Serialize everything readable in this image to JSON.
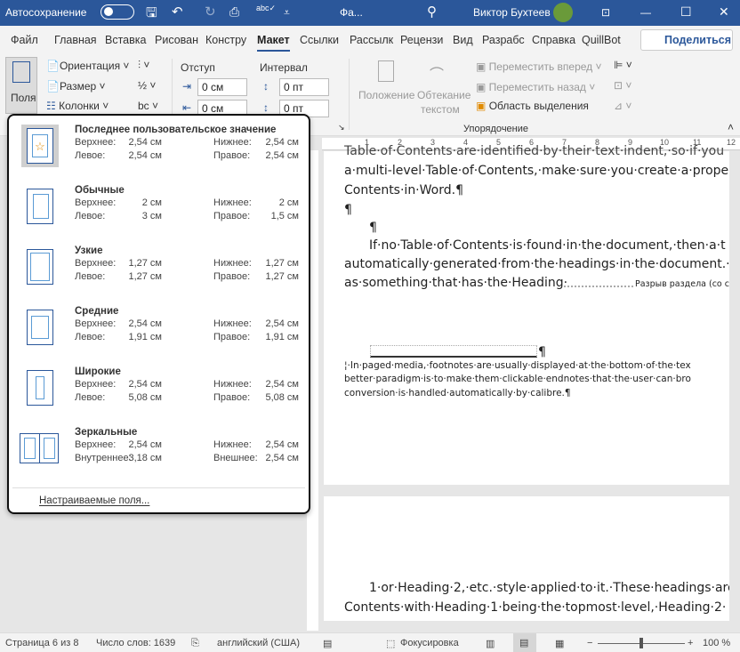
{
  "titlebar": {
    "autosave_label": "Автосохранение",
    "file_name": "Фа...",
    "user_name": "Виктор Бухтеев"
  },
  "tabs": [
    {
      "label": "Файл"
    },
    {
      "label": "Главная"
    },
    {
      "label": "Вставка"
    },
    {
      "label": "Рисован"
    },
    {
      "label": "Констру"
    },
    {
      "label": "Макет",
      "active": true
    },
    {
      "label": "Ссылки"
    },
    {
      "label": "Рассылк"
    },
    {
      "label": "Рецензи"
    },
    {
      "label": "Вид"
    },
    {
      "label": "Разрабс"
    },
    {
      "label": "Справка"
    },
    {
      "label": "QuillBot"
    }
  ],
  "share_label": "Поделиться",
  "ribbon": {
    "margins": "Поля",
    "orientation": "Ориентация",
    "size": "Размер",
    "columns": "Колонки",
    "indent_label": "Отступ",
    "spacing_label": "Интервал",
    "indent_left": "0 см",
    "indent_right": "0 см",
    "spacing_before": "0 пт",
    "spacing_after": "0 пт",
    "position": "Положение",
    "wrap_text_1": "Обтекание",
    "wrap_text_2": "текстом",
    "bring_forward": "Переместить вперед",
    "send_backward": "Переместить назад",
    "selection_pane": "Область выделения",
    "arrange_group": "Упорядочение"
  },
  "ruler_ticks": [
    "1",
    "2",
    "3",
    "4",
    "5",
    "6",
    "7",
    "8",
    "9",
    "10",
    "11",
    "12"
  ],
  "margins_menu": {
    "items": [
      {
        "name": "Последнее пользовательское значение",
        "top_label": "Верхнее:",
        "top": "2,54 см",
        "bottom_label": "Нижнее:",
        "bottom": "2,54 см",
        "left_label": "Левое:",
        "left": "2,54 см",
        "right_label": "Правое:",
        "right": "2,54 см"
      },
      {
        "name": "Обычные",
        "top_label": "Верхнее:",
        "top": "2 см",
        "bottom_label": "Нижнее:",
        "bottom": "2 см",
        "left_label": "Левое:",
        "left": "3 см",
        "right_label": "Правое:",
        "right": "1,5 см"
      },
      {
        "name": "Узкие",
        "top_label": "Верхнее:",
        "top": "1,27 см",
        "bottom_label": "Нижнее:",
        "bottom": "1,27 см",
        "left_label": "Левое:",
        "left": "1,27 см",
        "right_label": "Правое:",
        "right": "1,27 см"
      },
      {
        "name": "Средние",
        "top_label": "Верхнее:",
        "top": "2,54 см",
        "bottom_label": "Нижнее:",
        "bottom": "2,54 см",
        "left_label": "Левое:",
        "left": "1,91 см",
        "right_label": "Правое:",
        "right": "1,91 см"
      },
      {
        "name": "Широкие",
        "top_label": "Верхнее:",
        "top": "2,54 см",
        "bottom_label": "Нижнее:",
        "bottom": "2,54 см",
        "left_label": "Левое:",
        "left": "5,08 см",
        "right_label": "Правое:",
        "right": "5,08 см"
      },
      {
        "name": "Зеркальные",
        "top_label": "Верхнее:",
        "top": "2,54 см",
        "bottom_label": "Нижнее:",
        "bottom": "2,54 см",
        "left_label": "Внутреннее:",
        "left": "3,18 см",
        "right_label": "Внешнее:",
        "right": "2,54 см"
      }
    ],
    "custom": "Настраиваемые поля..."
  },
  "document": {
    "lines": [
      "Table·of·Contents·are·identified·by·their·text·indent,·so·if·you",
      "a·multi-level·Table·of·Contents,·make·sure·you·create·a·prope",
      "Contents·in·Word.¶",
      "¶",
      "¶",
      "If·no·Table·of·Contents·is·found·in·the·document,·then·a·t",
      "automatically·generated·from·the·headings·in·the·document.·",
      "as·something·that·has·the·Heading·"
    ],
    "section_break": "Разрыв раздела (со сл",
    "footnote_mark": "¶",
    "footnotes": [
      "¦·In·paged·media,·footnotes·are·usually·displayed·at·the·bottom·of·the·tex",
      "better·paradigm·is·to·make·them·clickable·endnotes·that·the·user·can·bro",
      "conversion·is·handled·automatically·by·calibre.¶"
    ],
    "page2_lines": [
      "1·or·Heading·2,·etc.·style·applied·to·it.·These·headings·are",
      "Contents·with·Heading·1·being·the·topmost·level,·Heading·2·"
    ]
  },
  "statusbar": {
    "page": "Страница 6 из 8",
    "words": "Число слов: 1639",
    "language": "английский (США)",
    "focus": "Фокусировка",
    "zoom": "100 %",
    "zoom_percent": 100
  }
}
